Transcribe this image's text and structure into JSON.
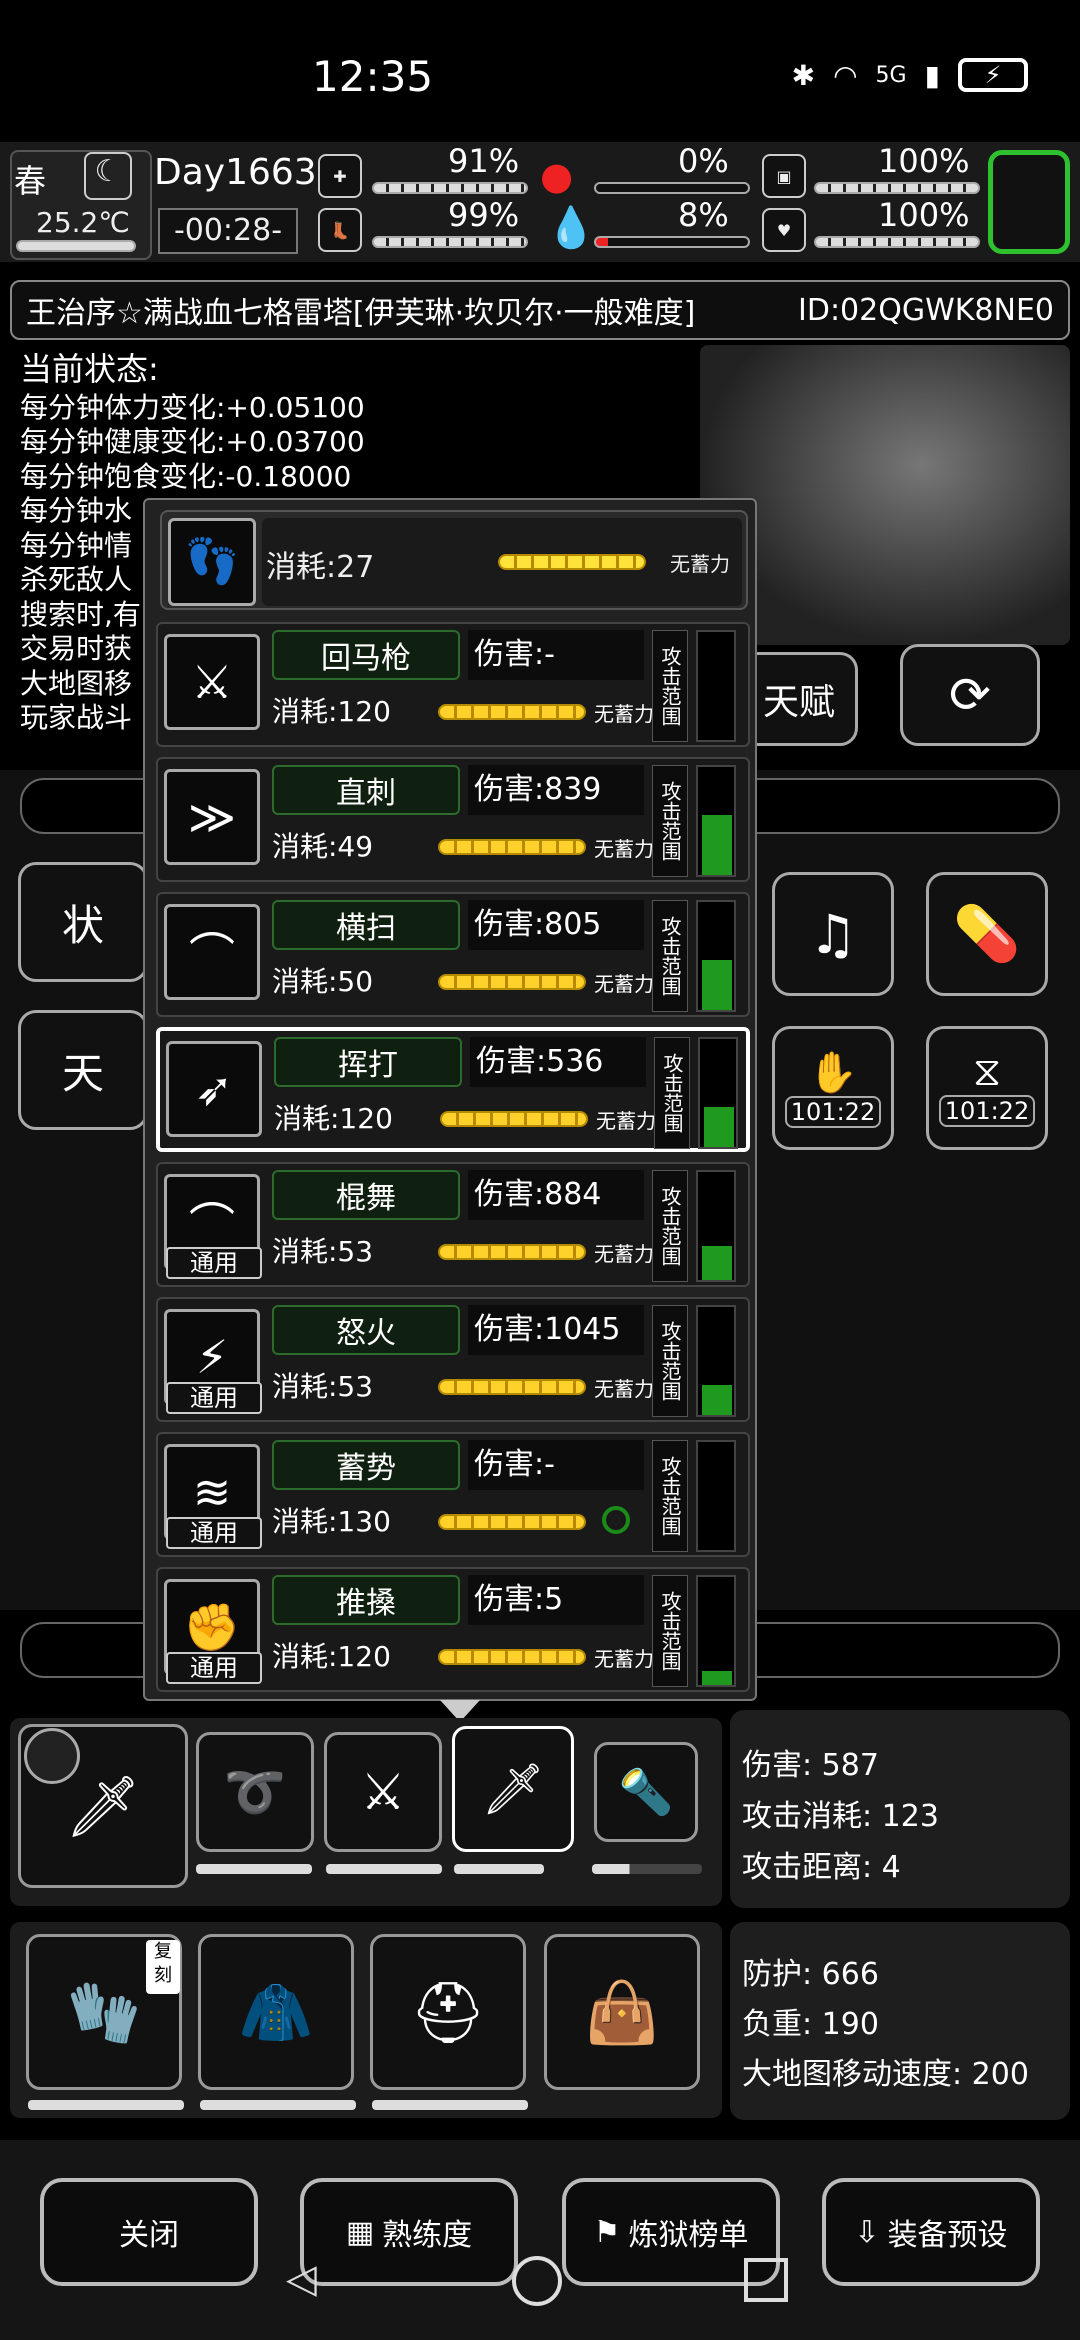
{
  "status_bar": {
    "time": "12:35",
    "network": "5G",
    "wifi_label": "6"
  },
  "top_stats": {
    "season": "春",
    "temperature": "25.2℃",
    "day": "Day1663",
    "clock": "-00:28-",
    "stamina": "91%",
    "hunger": "0%",
    "mood": "100%",
    "health_leg": "99%",
    "blood": "8%",
    "heart": "100%"
  },
  "title": {
    "text": "王治序☆满战血七格雷塔[伊芙琳·坎贝尔·一般难度]",
    "id": "ID:02QGWK8NE0"
  },
  "status_panel": {
    "heading": "当前状态:",
    "lines": [
      "每分钟体力变化:+0.05100",
      "每分钟健康变化:+0.03700",
      "每分钟饱食变化:-0.18000",
      "每分钟水",
      "每分钟情",
      "杀死敌人",
      "搜索时,有",
      "交易时获",
      "大地图移",
      "玩家战斗"
    ]
  },
  "right_buttons": {
    "talent": "天赋"
  },
  "left_tabs": {
    "tab1": "状",
    "tab2": "天"
  },
  "timers": {
    "timer1": "101:22",
    "timer2": "101:22"
  },
  "top_skill": {
    "cost": "消耗:27",
    "note": "无蓄力"
  },
  "skills": [
    {
      "name": "回马枪",
      "damage": "伤害:-",
      "cost": "消耗:120",
      "note": "无蓄力",
      "range": "攻击范围",
      "generic": ""
    },
    {
      "name": "直刺",
      "damage": "伤害:839",
      "cost": "消耗:49",
      "note": "无蓄力",
      "range": "攻击范围",
      "generic": ""
    },
    {
      "name": "横扫",
      "damage": "伤害:805",
      "cost": "消耗:50",
      "note": "无蓄力",
      "range": "攻击范围",
      "generic": ""
    },
    {
      "name": "挥打",
      "damage": "伤害:536",
      "cost": "消耗:120",
      "note": "无蓄力",
      "range": "攻击范围",
      "generic": ""
    },
    {
      "name": "棍舞",
      "damage": "伤害:884",
      "cost": "消耗:53",
      "note": "无蓄力",
      "range": "攻击范围",
      "generic": "通用"
    },
    {
      "name": "怒火",
      "damage": "伤害:1045",
      "cost": "消耗:53",
      "note": "无蓄力",
      "range": "攻击范围",
      "generic": "通用"
    },
    {
      "name": "蓄势",
      "damage": "伤害:-",
      "cost": "消耗:130",
      "note": "",
      "range": "攻击范围",
      "generic": "通用"
    },
    {
      "name": "推搡",
      "damage": "伤害:5",
      "cost": "消耗:120",
      "note": "无蓄力",
      "range": "攻击范围",
      "generic": "通用"
    }
  ],
  "weapon_info": {
    "damage": "伤害: 587",
    "cost": "攻击消耗: 123",
    "distance": "攻击距离: 4"
  },
  "armor_info": {
    "defense": "防护: 666",
    "weight": "负重: 190",
    "speed": "大地图移动速度: 200"
  },
  "armor_badge": "复刻",
  "bottom_buttons": {
    "close": "关闭",
    "skill": "熟练度",
    "rank": "炼狱榜单",
    "preset": "装备预设"
  }
}
